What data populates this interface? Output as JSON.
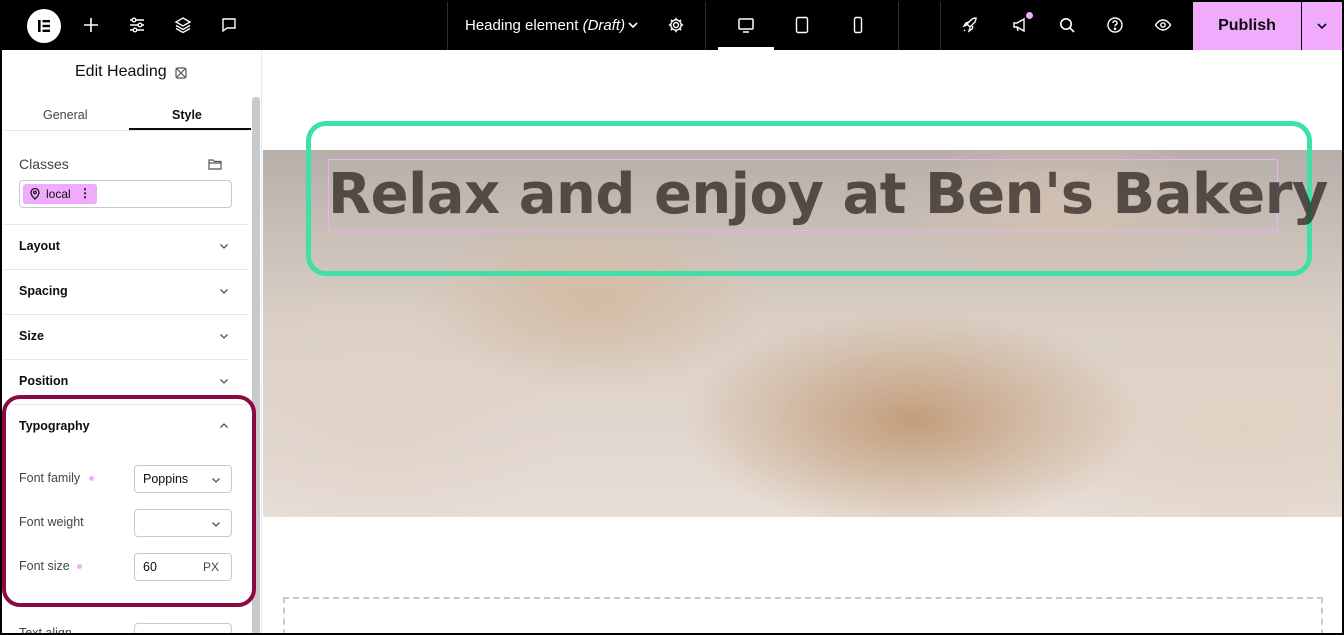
{
  "topbar": {
    "logo_icon": "elementor-logo-icon",
    "left_icons": [
      "plus-icon",
      "sliders-icon",
      "layers-icon",
      "chat-icon"
    ],
    "document": {
      "title": "Heading element",
      "status": "(Draft)"
    },
    "settings_icon": "gear-icon",
    "devices": [
      "desktop-icon",
      "tablet-icon",
      "mobile-icon"
    ],
    "active_device": "desktop",
    "right_icons": [
      "rocket-icon",
      "megaphone-icon",
      "search-icon",
      "help-icon",
      "eye-icon"
    ],
    "publish_label": "Publish",
    "accent": "#f0abfc"
  },
  "panel": {
    "title": "Edit Heading",
    "tabs": [
      {
        "label": "General"
      },
      {
        "label": "Style"
      }
    ],
    "active_tab": "Style",
    "classes": {
      "label": "Classes",
      "chip_label": "local"
    },
    "sections": [
      {
        "label": "Layout"
      },
      {
        "label": "Spacing"
      },
      {
        "label": "Size"
      },
      {
        "label": "Position"
      }
    ],
    "typography": {
      "label": "Typography",
      "font_family": {
        "label": "Font family",
        "value": "Poppins"
      },
      "font_weight": {
        "label": "Font weight",
        "value": ""
      },
      "font_size": {
        "label": "Font size",
        "value": "60",
        "unit": "PX"
      },
      "next_label": "Text align"
    },
    "highlight_color": "#8b0a3f"
  },
  "canvas": {
    "heading": "Relax and enjoy at Ben's Bakery",
    "outline_color": "#3fe0a8"
  }
}
